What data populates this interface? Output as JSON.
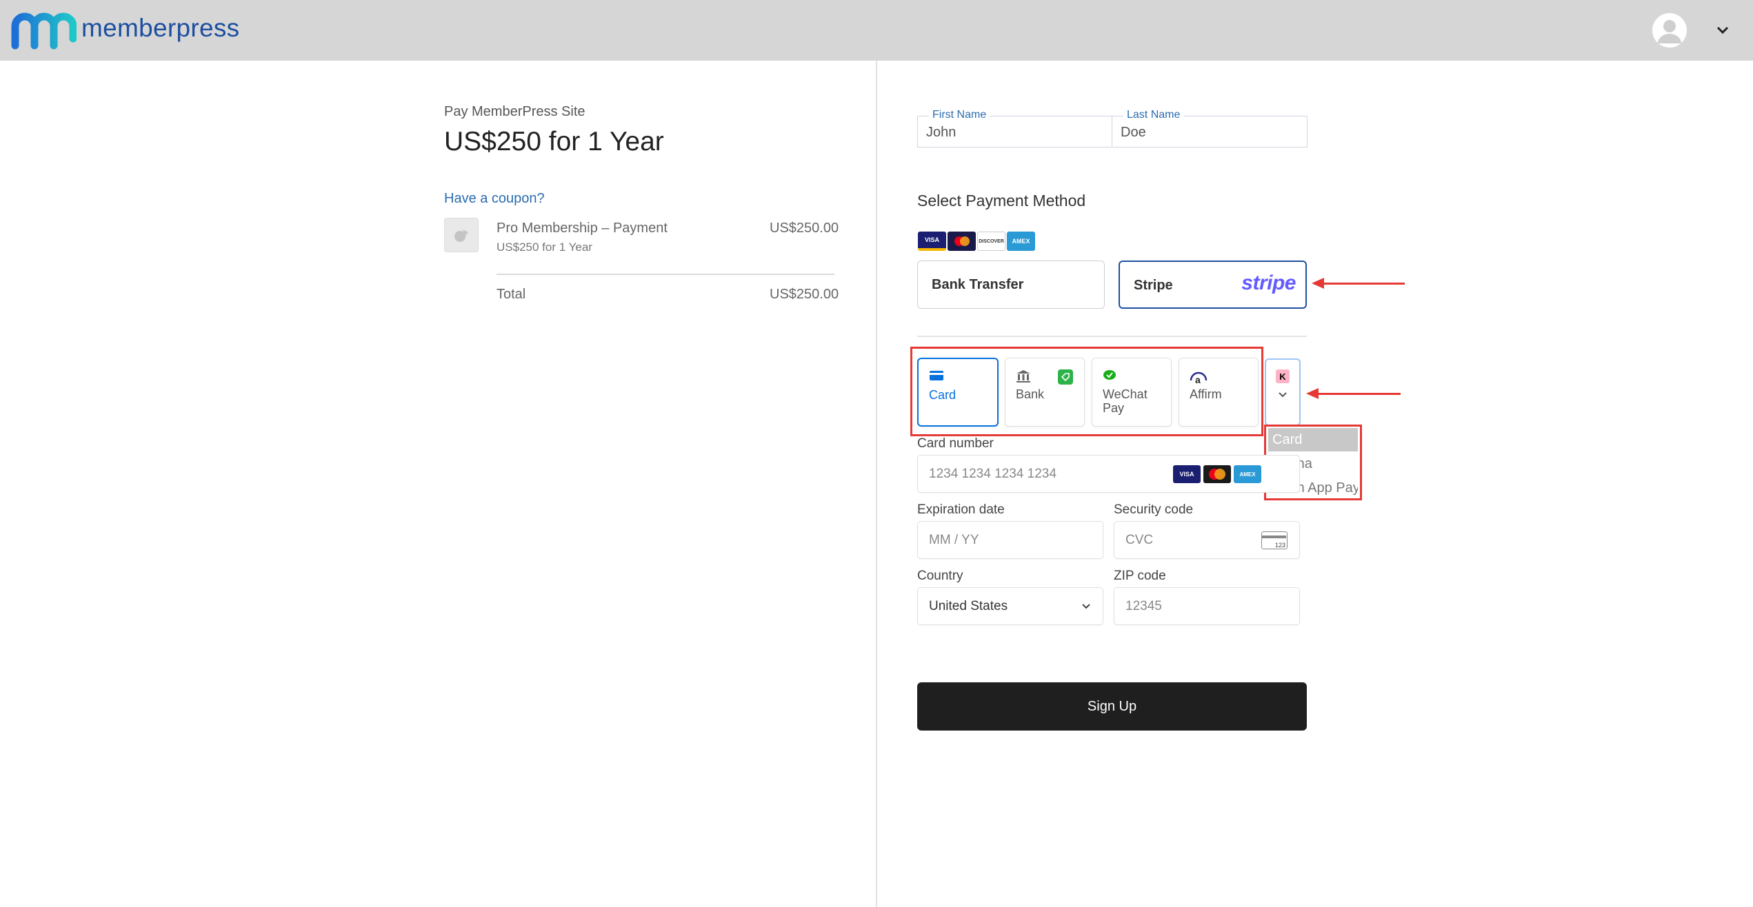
{
  "header": {
    "brand": "memberpress"
  },
  "summary": {
    "pay_site": "Pay MemberPress Site",
    "price_title": "US$250 for 1 Year",
    "coupon_link": "Have a coupon?",
    "product": {
      "name": "Pro Membership – Payment",
      "subtitle": "US$250 for 1 Year",
      "price": "US$250.00"
    },
    "total_label": "Total",
    "total_value": "US$250.00"
  },
  "form": {
    "first_name": {
      "label": "First Name",
      "value": "John"
    },
    "last_name": {
      "label": "Last Name",
      "value": "Doe"
    },
    "select_payment_method": "Select Payment Method",
    "accepted_cards": [
      "VISA",
      "MC",
      "DISCOVER",
      "AMEX"
    ],
    "gateways": [
      {
        "label": "Bank Transfer",
        "selected": false
      },
      {
        "label": "Stripe",
        "logo": "stripe",
        "selected": true
      }
    ],
    "payment_tabs": [
      {
        "label": "Card",
        "icon": "card-icon",
        "active": true
      },
      {
        "label": "Bank",
        "icon": "bank-icon",
        "active": false
      },
      {
        "label": "WeChat Pay",
        "icon": "wechat-icon",
        "active": false
      },
      {
        "label": "Affirm",
        "icon": "affirm-icon",
        "active": false
      }
    ],
    "more_tab_icon": "K",
    "dropdown_options": [
      "Card",
      "Klarna",
      "Cash App Pay"
    ],
    "dropdown_selected": "Card",
    "card_number": {
      "label": "Card number",
      "placeholder": "1234 1234 1234 1234"
    },
    "expiration": {
      "label": "Expiration date",
      "placeholder": "MM / YY"
    },
    "security_code": {
      "label": "Security code",
      "placeholder": "CVC",
      "icon_text": "123"
    },
    "country": {
      "label": "Country",
      "value": "United States"
    },
    "zip": {
      "label": "ZIP code",
      "placeholder": "12345"
    },
    "submit_label": "Sign Up"
  },
  "colors": {
    "brand_blue": "#1d4fa0",
    "stripe_purple": "#635bff",
    "annotation_red": "#e53935",
    "active_tab_blue": "#0570de",
    "button_dark": "#1f1f1f"
  }
}
